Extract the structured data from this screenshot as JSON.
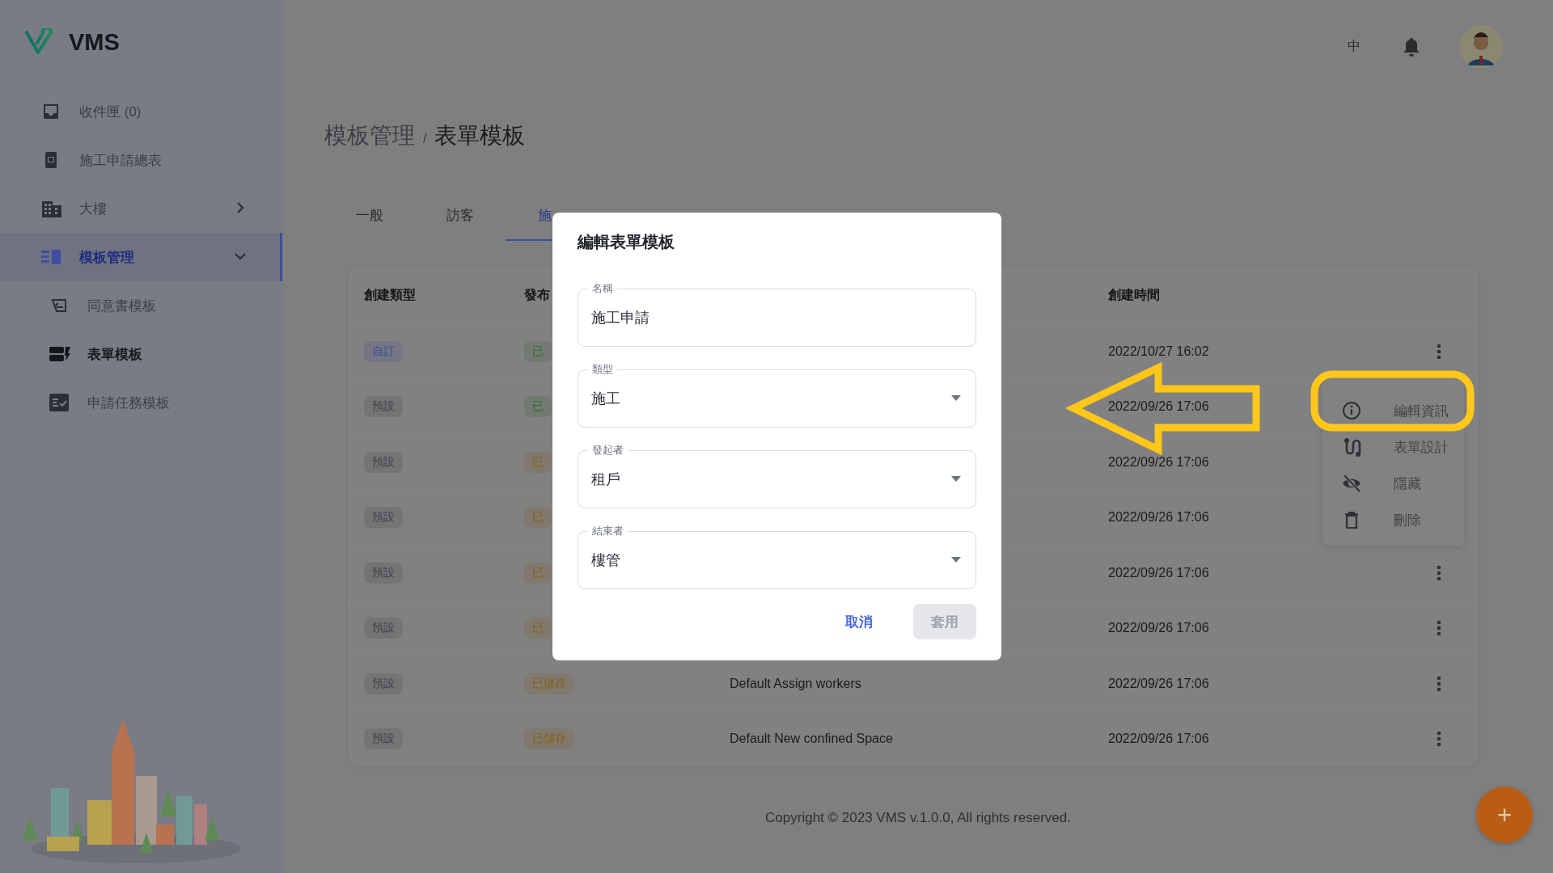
{
  "app": {
    "name": "VMS"
  },
  "sidebar": {
    "items": [
      {
        "kind": "inbox",
        "label": "收件匣 (0)",
        "selected": false
      },
      {
        "kind": "report",
        "label": "施工申請總表",
        "selected": false
      },
      {
        "kind": "building",
        "label": "大樓",
        "selected": false,
        "expanded": false
      },
      {
        "kind": "template",
        "label": "模板管理",
        "selected": true,
        "expanded": true,
        "children": [
          {
            "kind": "consent",
            "label": "同意書模板",
            "selected": false
          },
          {
            "kind": "form",
            "label": "表單模板",
            "selected": true
          },
          {
            "kind": "task",
            "label": "申請任務模板",
            "selected": false
          }
        ]
      }
    ]
  },
  "header": {
    "language": "中"
  },
  "breadcrumb": {
    "items": [
      "模板管理",
      "表單模板"
    ],
    "separator": "/"
  },
  "tabs": [
    {
      "label": "一般",
      "selected": false
    },
    {
      "label": "訪客",
      "selected": false
    },
    {
      "label": "施",
      "selected": true
    }
  ],
  "table": {
    "column_headers": {
      "column_1": "創建類型",
      "column_2": "發布",
      "column_4": "創建時間"
    },
    "rows": [
      {
        "type": {
          "label": "自訂",
          "color": "#3a4a9a"
        },
        "status": {
          "label": "已",
          "color": "#2f6a2c"
        },
        "time": "2022/10/27 16:02",
        "more_icon": true
      },
      {
        "type": {
          "label": "預設",
          "color": "#3a3d42"
        },
        "status": {
          "label": "已",
          "color": "#2f6a2c"
        },
        "time": "2022/09/26 17:06",
        "more_icon": false
      },
      {
        "type": {
          "label": "預設",
          "color": "#3a3d42"
        },
        "status": {
          "label": "已",
          "color": "#8a6010"
        },
        "time": "2022/09/26 17:06",
        "more_icon": false
      },
      {
        "type": {
          "label": "預設",
          "color": "#3a3d42"
        },
        "status": {
          "label": "已",
          "color": "#8a6010"
        },
        "time": "2022/09/26 17:06",
        "more_icon": false
      },
      {
        "type": {
          "label": "預設",
          "color": "#3a3d42"
        },
        "status": {
          "label": "已",
          "color": "#8a6010"
        },
        "time": "2022/09/26 17:06",
        "more_icon": true
      },
      {
        "type": {
          "label": "預設",
          "color": "#3a3d42"
        },
        "status": {
          "label": "已",
          "color": "#8a6010"
        },
        "time": "2022/09/26 17:06",
        "more_icon": true
      },
      {
        "type": {
          "label": "預設",
          "color": "#3a3d42"
        },
        "status": {
          "label": "已儲存",
          "color": "#8a6010"
        },
        "name": "Default Assign workers",
        "time": "2022/09/26 17:06",
        "more_icon": true
      },
      {
        "type": {
          "label": "預設",
          "color": "#3a3d42"
        },
        "status": {
          "label": "已儲存",
          "color": "#8a6010"
        },
        "name": "Default New confined Space",
        "time": "2022/09/26 17:06",
        "more_icon": true
      }
    ]
  },
  "row_menu": {
    "items": [
      {
        "kind": "info",
        "label": "編輯資訊"
      },
      {
        "kind": "design",
        "label": "表單設計"
      },
      {
        "kind": "hide",
        "label": "隱藏"
      },
      {
        "kind": "delete",
        "label": "刪除"
      }
    ]
  },
  "dialog": {
    "title": "編輯表單模板",
    "fields": [
      {
        "kind": "text",
        "label": "名稱",
        "value": "施工申請"
      },
      {
        "kind": "select",
        "label": "類型",
        "value": "施工"
      },
      {
        "kind": "select",
        "label": "發起者",
        "value": "租戶"
      },
      {
        "kind": "select",
        "label": "結束者",
        "value": "樓管"
      }
    ],
    "buttons": [
      {
        "kind": "text",
        "label": "取消",
        "disabled": false
      },
      {
        "kind": "filled",
        "label": "套用",
        "disabled": true
      }
    ]
  },
  "footer": "Copyright © 2023 VMS v.1.0.0, All rights reserved.",
  "fab": {
    "label": "+"
  }
}
